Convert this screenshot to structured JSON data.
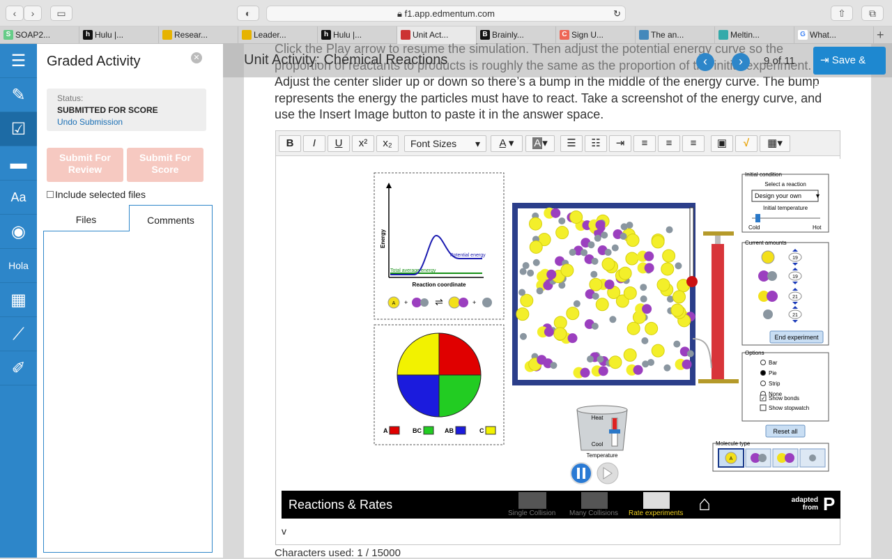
{
  "browser": {
    "url": "f1.app.edmentum.com",
    "tabs": [
      {
        "label": "SOAP2...",
        "icon": "S",
        "color": "#6c8"
      },
      {
        "label": "Hulu |...",
        "icon": "h",
        "color": "#111"
      },
      {
        "label": "Resear...",
        "icon": "",
        "color": "#e6b300"
      },
      {
        "label": "Leader...",
        "icon": "",
        "color": "#e6b300"
      },
      {
        "label": "Hulu |...",
        "icon": "h",
        "color": "#111"
      },
      {
        "label": "Unit Act...",
        "icon": "",
        "color": "#c33"
      },
      {
        "label": "Brainly...",
        "icon": "B",
        "color": "#111"
      },
      {
        "label": "Sign U...",
        "icon": "C",
        "color": "#e65"
      },
      {
        "label": "The an...",
        "icon": "",
        "color": "#48b"
      },
      {
        "label": "Meltin...",
        "icon": "",
        "color": "#3aa"
      },
      {
        "label": "What...",
        "icon": "G",
        "color": "#fff"
      }
    ]
  },
  "panel": {
    "title": "Graded Activity",
    "status_label": "Status:",
    "status_value": "SUBMITTED FOR SCORE",
    "undo_label": "Undo Submission",
    "submit_review": "Submit For Review",
    "submit_score": "Submit For Score",
    "include_label": "Include selected files",
    "tab_files": "Files",
    "tab_comments": "Comments"
  },
  "header": {
    "title": "Unit Activity: Chemical Reactions",
    "page_current": "9",
    "page_of": "of",
    "page_total": "11",
    "save_label": "Save & Exit"
  },
  "instructions": "Click the Play arrow to resume the simulation. Then adjust the potential energy curve so the proportion of reactants to products is roughly the same as the proportion of the initial experiment. Adjust the center slider up or down so there’s a bump in the middle of the energy curve. The bump represents the energy the particles must have to react. Take a screenshot of the energy curve, and use the Insert Image button to paste it in the answer space.",
  "editor": {
    "font_sizes": "Font Sizes",
    "answer_text": "v",
    "chars_used": "Characters used: 1 / 15000"
  },
  "sim": {
    "energy_label": "Energy",
    "reaction_coord": "Reaction coordinate",
    "potential_energy": "Potential energy",
    "total_avg_energy": "Total average energy",
    "pie_legend": [
      {
        "label": "A",
        "color": "#e00000"
      },
      {
        "label": "BC",
        "color": "#22cc22"
      },
      {
        "label": "AB",
        "color": "#1b1bdd"
      },
      {
        "label": "C",
        "color": "#f2f200"
      }
    ],
    "pie_fractions": [
      0.25,
      0.25,
      0.25,
      0.25
    ],
    "initial_condition": "Initial condition",
    "select_reaction": "Select a reaction",
    "reaction_value": "Design your own",
    "initial_temp": "Initial temperature",
    "cold": "Cold",
    "hot": "Hot",
    "current_amounts": "Current amounts",
    "amounts": [
      "19",
      "19",
      "21",
      "21"
    ],
    "end_experiment": "End experiment",
    "options": "Options",
    "option_items": [
      "Bar",
      "Pie",
      "Strip",
      "None"
    ],
    "show_bonds": "Show bonds",
    "show_stopwatch": "Show stopwatch",
    "reset_all": "Reset all",
    "molecule_type": "Molecule type",
    "heat": "Heat",
    "cool": "Cool",
    "temperature": "Temperature",
    "footer_title": "Reactions & Rates",
    "footer_tabs": [
      "Single Collision",
      "Many Collisions",
      "Rate experiments"
    ],
    "adapted": "adapted",
    "from": "from",
    "phet_letter": "P"
  },
  "colors": {
    "brand_blue": "#2d86c9",
    "accent": "#1e88d0"
  }
}
